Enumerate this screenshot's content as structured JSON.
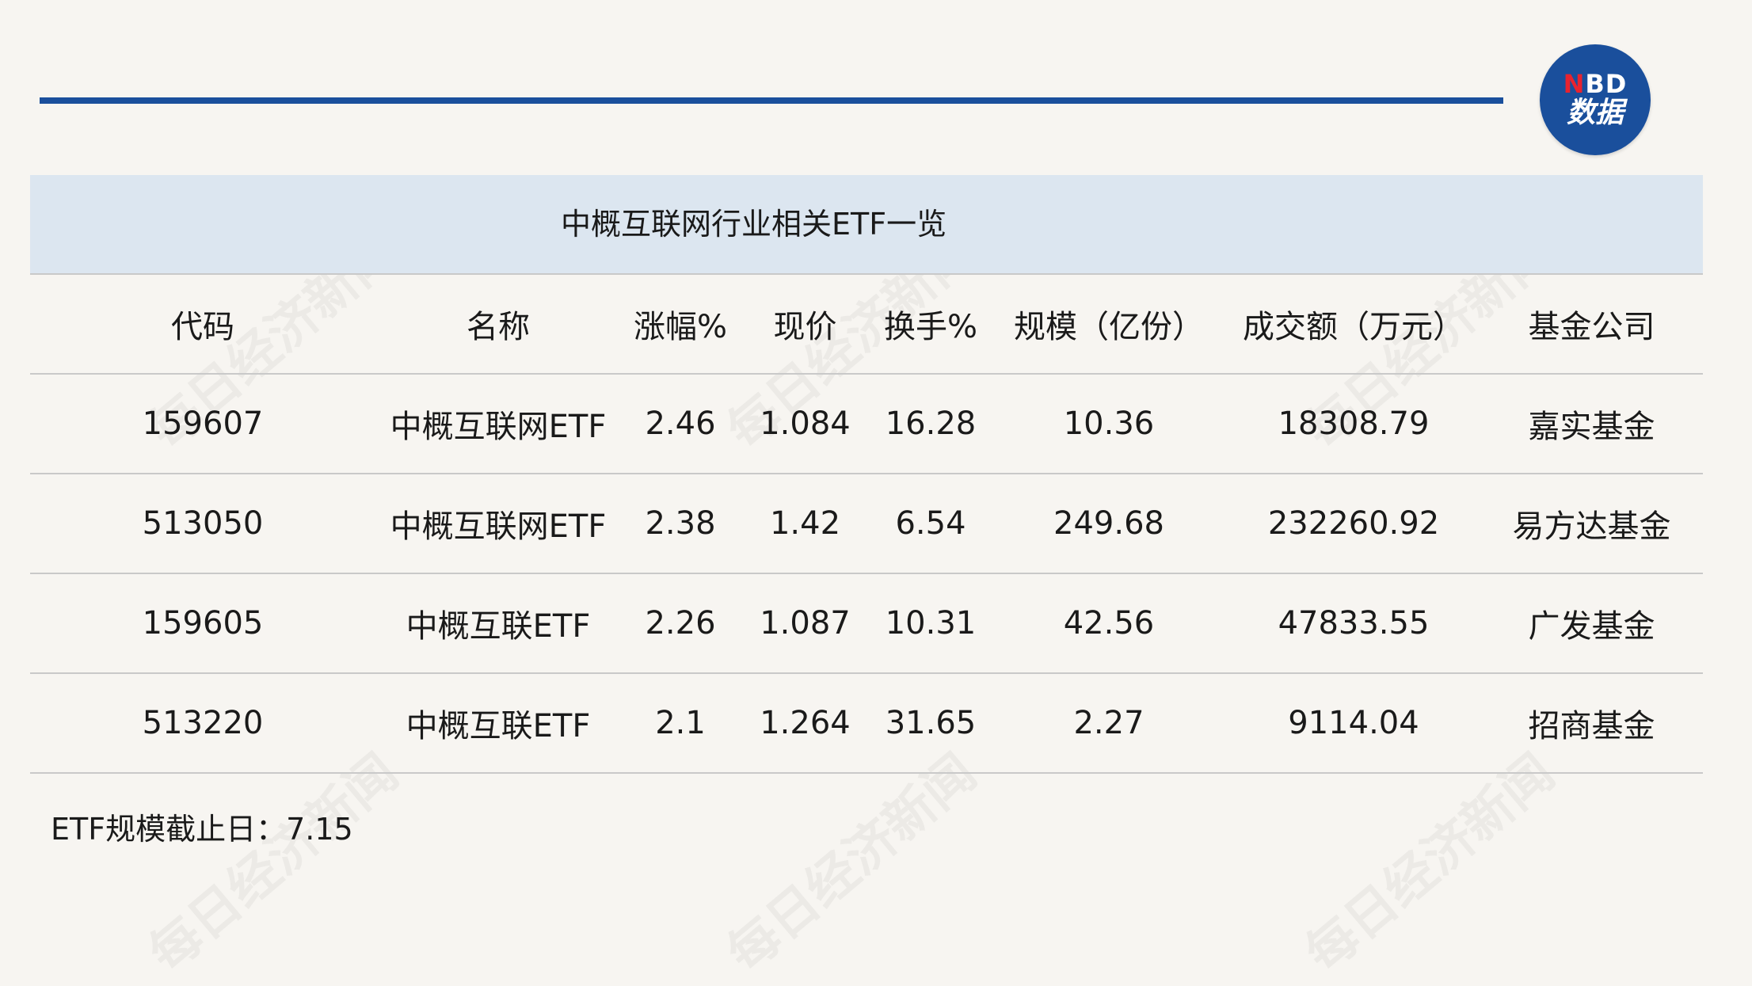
{
  "logo": {
    "line1_n": "N",
    "line1_rest": "BD",
    "line2": "数据"
  },
  "table": {
    "title": "中概互联网行业相关ETF一览",
    "headers": [
      "代码",
      "名称",
      "涨幅%",
      "现价",
      "换手%",
      "规模（亿份）",
      "成交额（万元）",
      "基金公司"
    ],
    "rows": [
      [
        "159607",
        "中概互联网ETF",
        "2.46",
        "1.084",
        "16.28",
        "10.36",
        "18308.79",
        "嘉实基金"
      ],
      [
        "513050",
        "中概互联网ETF",
        "2.38",
        "1.42",
        "6.54",
        "249.68",
        "232260.92",
        "易方达基金"
      ],
      [
        "159605",
        "中概互联ETF",
        "2.26",
        "1.087",
        "10.31",
        "42.56",
        "47833.55",
        "广发基金"
      ],
      [
        "513220",
        "中概互联ETF",
        "2.1",
        "1.264",
        "31.65",
        "2.27",
        "9114.04",
        "招商基金"
      ]
    ]
  },
  "footnote": "ETF规模截止日：7.15",
  "watermark": "每日经济新闻"
}
